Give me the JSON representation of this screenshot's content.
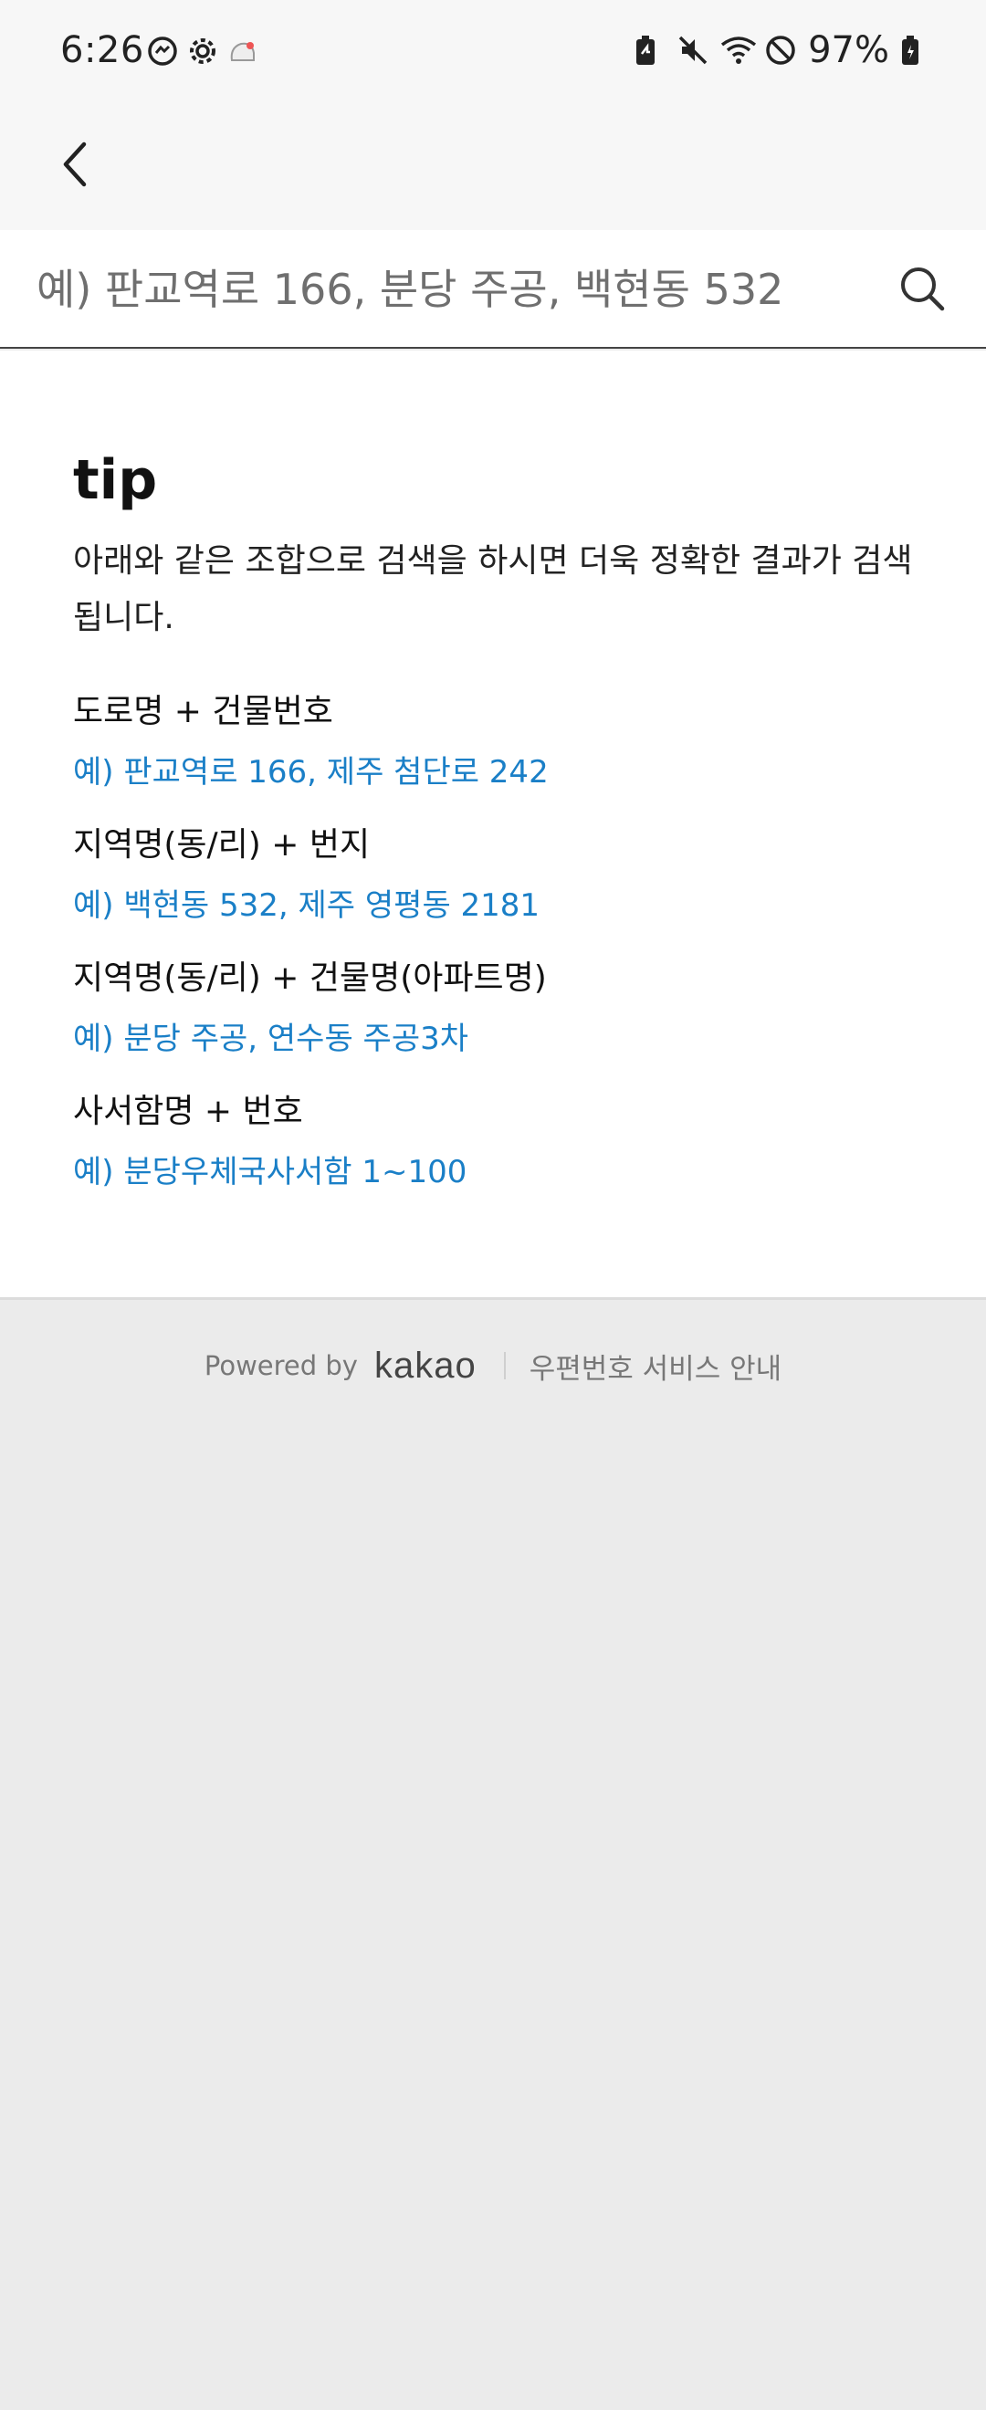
{
  "status_bar": {
    "time": "6:26",
    "battery": "97%",
    "left_icons": [
      "messenger-icon",
      "settings-icon",
      "cloud-icon"
    ],
    "right_icons": [
      "battery-saver-icon",
      "mute-icon",
      "wifi-icon",
      "do-not-disturb-icon",
      "battery-icon"
    ]
  },
  "search": {
    "placeholder": "예) 판교역로 166, 분당 주공, 백현동 532",
    "value": ""
  },
  "tip": {
    "title": "tip",
    "description": "아래와 같은 조합으로 검색을 하시면 더욱 정확한 결과가 검색됩니다.",
    "rules": [
      {
        "label": "도로명 + 건물번호",
        "example": "예) 판교역로 166,  제주 첨단로 242"
      },
      {
        "label": "지역명(동/리) + 번지",
        "example": "예) 백현동 532,  제주 영평동 2181"
      },
      {
        "label": "지역명(동/리) + 건물명(아파트명)",
        "example": "예) 분당 주공,  연수동 주공3차"
      },
      {
        "label": "사서함명 + 번호",
        "example": "예) 분당우체국사서함 1~100"
      }
    ]
  },
  "footer": {
    "powered_by": "Powered by",
    "brand": "kakao",
    "service_link": "우편번호 서비스 안내"
  },
  "colors": {
    "example_text": "#1a7fc7",
    "header_bg": "#f7f7f7",
    "page_bg": "#ebebeb"
  }
}
